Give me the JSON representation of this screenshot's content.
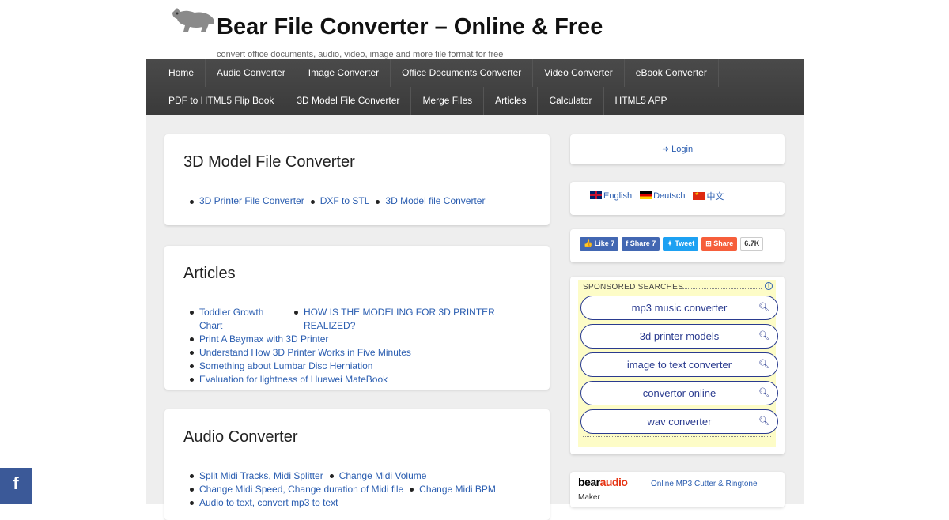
{
  "header": {
    "title": "Bear File Converter – Online & Free",
    "tagline": "convert office documents, audio, video, image and more file format for free",
    "logo_icon": "bear-logo-icon"
  },
  "nav": {
    "row1": [
      "Home",
      "Audio Converter",
      "Image Converter",
      "Office Documents Converter",
      "Video Converter",
      "eBook Converter"
    ],
    "row2": [
      "PDF to HTML5 Flip Book",
      "3D Model File Converter",
      "Merge Files",
      "Articles",
      "Calculator",
      "HTML5 APP"
    ]
  },
  "cards": {
    "model3d": {
      "title": "3D Model File Converter",
      "links": [
        "3D Printer File Converter",
        "DXF to STL",
        "3D Model file Converter"
      ]
    },
    "articles": {
      "title": "Articles",
      "row1": [
        "Toddler Growth Chart",
        "HOW IS THE MODELING FOR 3D PRINTER REALIZED?"
      ],
      "links": [
        "Print A Baymax with 3D Printer",
        "Understand How 3D Printer Works in Five Minutes",
        "Something about Lumbar Disc Herniation",
        "Evaluation for lightness of Huawei MateBook"
      ]
    },
    "audio": {
      "title": "Audio Converter",
      "row1": [
        "Split Midi Tracks, Midi Splitter",
        "Change Midi Volume"
      ],
      "row2": [
        "Change Midi Speed, Change duration of Midi file",
        "Change Midi BPM"
      ],
      "row3": [
        "Audio to text, convert mp3 to text"
      ]
    }
  },
  "sidebar": {
    "login": "Login",
    "languages": [
      "English",
      "Deutsch",
      "中文"
    ],
    "share": {
      "like": "Like 7",
      "share_fb": "Share 7",
      "tweet": "Tweet",
      "share": "Share",
      "count": "6.7K"
    },
    "sponsored": {
      "heading": "SPONSORED SEARCHES",
      "items": [
        "mp3 music converter",
        "3d printer models",
        "image to text converter",
        "convertor online",
        "wav converter"
      ]
    },
    "bearaudio": {
      "logo_a": "bear",
      "logo_b": "audio",
      "link": "Online MP3 Cutter & Ringtone",
      "maker": "Maker"
    }
  },
  "floating": {
    "facebook": "f"
  }
}
